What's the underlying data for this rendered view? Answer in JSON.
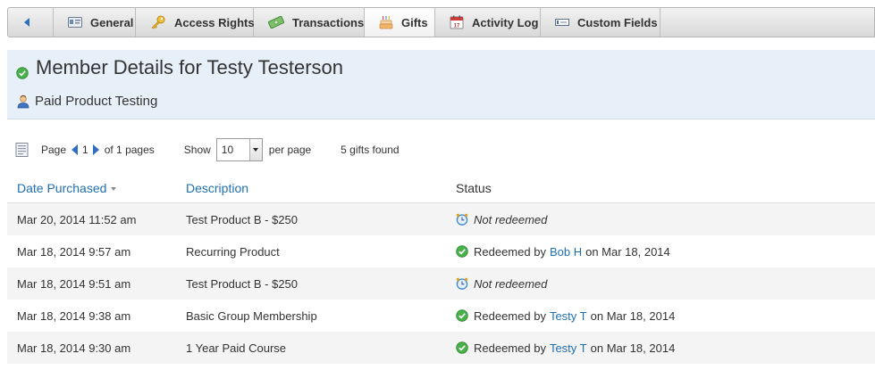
{
  "tabs": [
    {
      "key": "back",
      "label": "",
      "icon": "back-arrow-icon"
    },
    {
      "key": "general",
      "label": "General",
      "icon": "id-card-icon"
    },
    {
      "key": "access",
      "label": "Access Rights",
      "icon": "key-icon"
    },
    {
      "key": "transactions",
      "label": "Transactions",
      "icon": "money-icon"
    },
    {
      "key": "gifts",
      "label": "Gifts",
      "icon": "gift-cake-icon",
      "active": true
    },
    {
      "key": "activity",
      "label": "Activity Log",
      "icon": "calendar-icon"
    },
    {
      "key": "custom",
      "label": "Custom Fields",
      "icon": "form-field-icon"
    }
  ],
  "header": {
    "title": "Member Details for Testy Testerson",
    "subtitle": "Paid Product Testing"
  },
  "pager": {
    "page_label": "Page",
    "current_page": "1",
    "of_pages": "of 1 pages",
    "show_label": "Show",
    "per_page_value": "10",
    "per_page_label": "per page",
    "found": "5 gifts found"
  },
  "table": {
    "columns": [
      "Date Purchased",
      "Description",
      "Status"
    ],
    "rows": [
      {
        "date": "Mar 20, 2014 11:52 am",
        "description": "Test Product B - $250",
        "status_type": "pending",
        "status_text": "Not redeemed"
      },
      {
        "date": "Mar 18, 2014 9:57 am",
        "description": "Recurring Product",
        "status_type": "redeemed",
        "prefix": "Redeemed by",
        "user": "Bob H",
        "suffix": "on Mar 18, 2014"
      },
      {
        "date": "Mar 18, 2014 9:51 am",
        "description": "Test Product B - $250",
        "status_type": "pending",
        "status_text": "Not redeemed"
      },
      {
        "date": "Mar 18, 2014 9:38 am",
        "description": "Basic Group Membership",
        "status_type": "redeemed",
        "prefix": "Redeemed by",
        "user": "Testy T",
        "suffix": "on Mar 18, 2014"
      },
      {
        "date": "Mar 18, 2014 9:30 am",
        "description": "1 Year Paid Course",
        "status_type": "redeemed",
        "prefix": "Redeemed by",
        "user": "Testy T",
        "suffix": "on Mar 18, 2014"
      }
    ]
  },
  "colors": {
    "link": "#1f6fb2",
    "header_bg": "#e7f0f9",
    "status_green": "#49b04a",
    "clock_blue": "#3d87d3"
  }
}
